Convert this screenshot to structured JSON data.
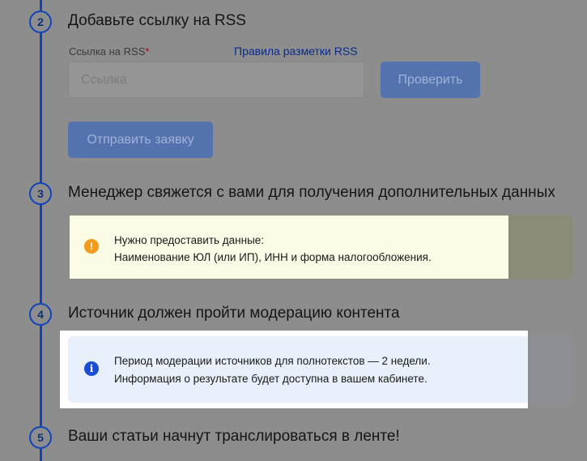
{
  "steps": [
    {
      "number": "2",
      "title": "Добавьте ссылку на RSS"
    },
    {
      "number": "3",
      "title": "Менеджер свяжется с вами для получения дополнительных данных"
    },
    {
      "number": "4",
      "title": "Источник должен пройти модерацию контента"
    },
    {
      "number": "5",
      "title": "Ваши статьи начнут транслироваться в ленте!"
    }
  ],
  "rss_form": {
    "label": "Ссылка на RSS",
    "required_mark": "*",
    "rules_link": "Правила разметки RSS",
    "input_placeholder": "Ссылка",
    "input_value": "",
    "check_button": "Проверить",
    "submit_button": "Отправить заявку"
  },
  "warning_notice": {
    "icon": "exclamation-icon",
    "color": "#f29a1b",
    "line1": "Нужно предоставить данные:",
    "line2": "Наименование ЮЛ (или ИП), ИНН и форма налогообложения."
  },
  "info_notice": {
    "icon": "info-icon",
    "color": "#1a4fd4",
    "line1": "Период модерации источников для полнотекстов — 2 недели.",
    "line2": "Информация о результате будет доступна в вашем кабинете."
  },
  "accent_color": "#1144bb"
}
